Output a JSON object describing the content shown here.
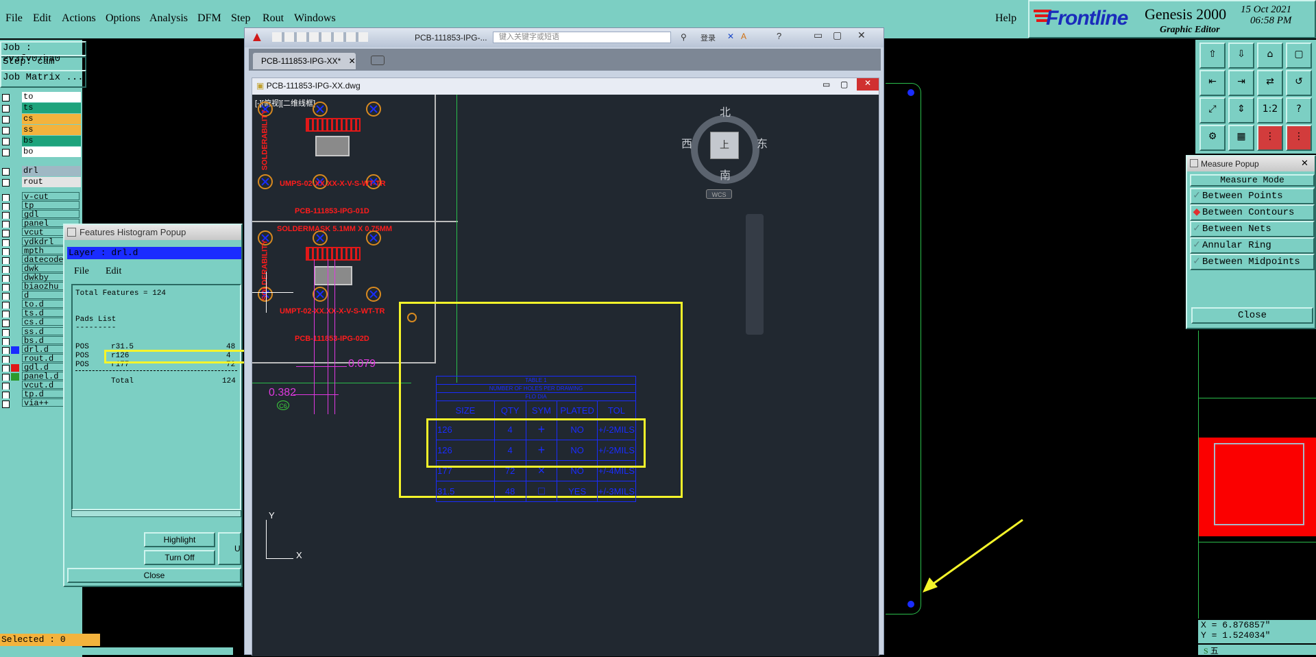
{
  "menubar": {
    "items": [
      "File",
      "Edit",
      "Actions",
      "Options",
      "Analysis",
      "DFM",
      "Step",
      "Rout",
      "Windows"
    ],
    "help": "Help"
  },
  "brand": {
    "logo": "Frontline",
    "product": "Genesis 2000",
    "subtitle": "Graphic Editor",
    "date": "15 Oct 2021",
    "time": "06:58 PM"
  },
  "left_panel": {
    "job": "Job : 2v3fv07ha0",
    "step": "Step: cam",
    "job_matrix": "Job Matrix ...",
    "selected": "Selected : 0",
    "layers": [
      {
        "name": "to",
        "color": "#ffffff"
      },
      {
        "name": "ts",
        "color": "#1ea37c"
      },
      {
        "name": "cs",
        "color": "#f3b33d"
      },
      {
        "name": "ss",
        "color": "#f3b33d"
      },
      {
        "name": "bs",
        "color": "#1ea37c"
      },
      {
        "name": "bo",
        "color": "#ffffff"
      },
      {
        "name": "drl",
        "color": "#9fb8c4"
      },
      {
        "name": "rout",
        "color": "#e4e4e4"
      },
      {
        "name": "v-cut",
        "color": "#7ccfc3"
      },
      {
        "name": "tp",
        "color": "#7ccfc3"
      },
      {
        "name": "gdl",
        "color": "#7ccfc3"
      },
      {
        "name": "panel",
        "color": "#7ccfc3"
      },
      {
        "name": "vcut",
        "color": "#7ccfc3"
      },
      {
        "name": "ydkdrl",
        "color": "#7ccfc3"
      },
      {
        "name": "mpth",
        "color": "#7ccfc3"
      },
      {
        "name": "datecode",
        "color": "#7ccfc3"
      },
      {
        "name": "dwk",
        "color": "#7ccfc3"
      },
      {
        "name": "dwkby",
        "color": "#7ccfc3"
      },
      {
        "name": "biaozhu",
        "color": "#7ccfc3"
      },
      {
        "name": "d",
        "color": "#7ccfc3"
      },
      {
        "name": "to.d",
        "color": "#7ccfc3"
      },
      {
        "name": "ts.d",
        "color": "#7ccfc3"
      },
      {
        "name": "cs.d",
        "color": "#7ccfc3"
      },
      {
        "name": "ss.d",
        "color": "#7ccfc3"
      },
      {
        "name": "bs.d",
        "color": "#7ccfc3"
      },
      {
        "name": "drl.d",
        "color": "#7ccfc3",
        "swatch": "#1a2cff"
      },
      {
        "name": "rout.d",
        "color": "#7ccfc3"
      },
      {
        "name": "gdl.d",
        "color": "#7ccfc3",
        "swatch": "#e01818"
      },
      {
        "name": "panel.d",
        "color": "#7ccfc3",
        "swatch": "#2c9a2c"
      },
      {
        "name": "vcut.d",
        "color": "#7ccfc3"
      },
      {
        "name": "tp.d",
        "color": "#7ccfc3"
      },
      {
        "name": "via++",
        "color": "#7ccfc3"
      }
    ]
  },
  "histogram": {
    "title": "Features Histogram Popup",
    "layer": "Layer :  drl.d",
    "menu": [
      "File",
      "Edit"
    ],
    "total": "Total Features = 124",
    "pads_list": "Pads List",
    "dashes": "---------",
    "rows": [
      {
        "type": "POS",
        "sym": "r31.5",
        "count": "48"
      },
      {
        "type": "POS",
        "sym": "r126",
        "count": "4"
      },
      {
        "type": "POS",
        "sym": "r177",
        "count": "72"
      }
    ],
    "total_label": "Total",
    "total_count": "124",
    "buttons": {
      "highlight": "Highlight",
      "turn_off": "Turn Off",
      "u": "U",
      "close": "Close"
    }
  },
  "autocad": {
    "tab": "PCB-111853-IPG-XX*",
    "title_center": "PCB-111853-IPG-...",
    "search_placeholder": "键入关键字或短语",
    "login": "登录",
    "drawing_title": "PCB-111853-IPG-XX.dwg",
    "view_label": "[-][俯视][二维线框]",
    "compass": {
      "n": "北",
      "s": "南",
      "w": "西",
      "e": "东",
      "center": "上",
      "wcs": "WCS"
    },
    "red_labels": [
      "UMPS-02-XX.XX-X-V-S-WT-TR",
      "PCB-111853-IPG-01D",
      "SOLDERMASK 5.1MM X 0.75MM",
      "UMPT-02-XX.XX-X-V-S-WT-TR",
      "PCB-111853-IPG-02D",
      "SOLDERABILITY",
      "SOLDERABILITY"
    ],
    "dim1": "0.079",
    "dim2": "0.382",
    "tag": "C6",
    "axis_y": "Y",
    "axis_x": "X",
    "table": {
      "title": "TABLE 1",
      "sub1": "NUMBER OF HOLES PER DRAWING",
      "sub2": "FLO DIA",
      "headers": [
        "SIZE",
        "QTY",
        "SYM",
        "PLATED",
        "TOL"
      ],
      "rows": [
        [
          "126",
          "4",
          "+",
          "NO",
          "+/-2MILS"
        ],
        [
          "126",
          "4",
          "+",
          "NO",
          "+/-2MILS"
        ],
        [
          "177",
          "72",
          "×",
          "NO",
          "+/-4MILS"
        ],
        [
          "31.5",
          "48",
          "□",
          "YES",
          "+/-3MILS"
        ]
      ]
    }
  },
  "measure": {
    "title": "Measure Popup",
    "mode": "Measure Mode",
    "options": [
      "Between Points",
      "Between Contours",
      "Between Nets",
      "Annular Ring",
      "Between Midpoints"
    ],
    "selected": 1,
    "close": "Close"
  },
  "coords": {
    "x": "X = 6.876857\"",
    "y": "Y = 1.524034\""
  },
  "tray": "五"
}
